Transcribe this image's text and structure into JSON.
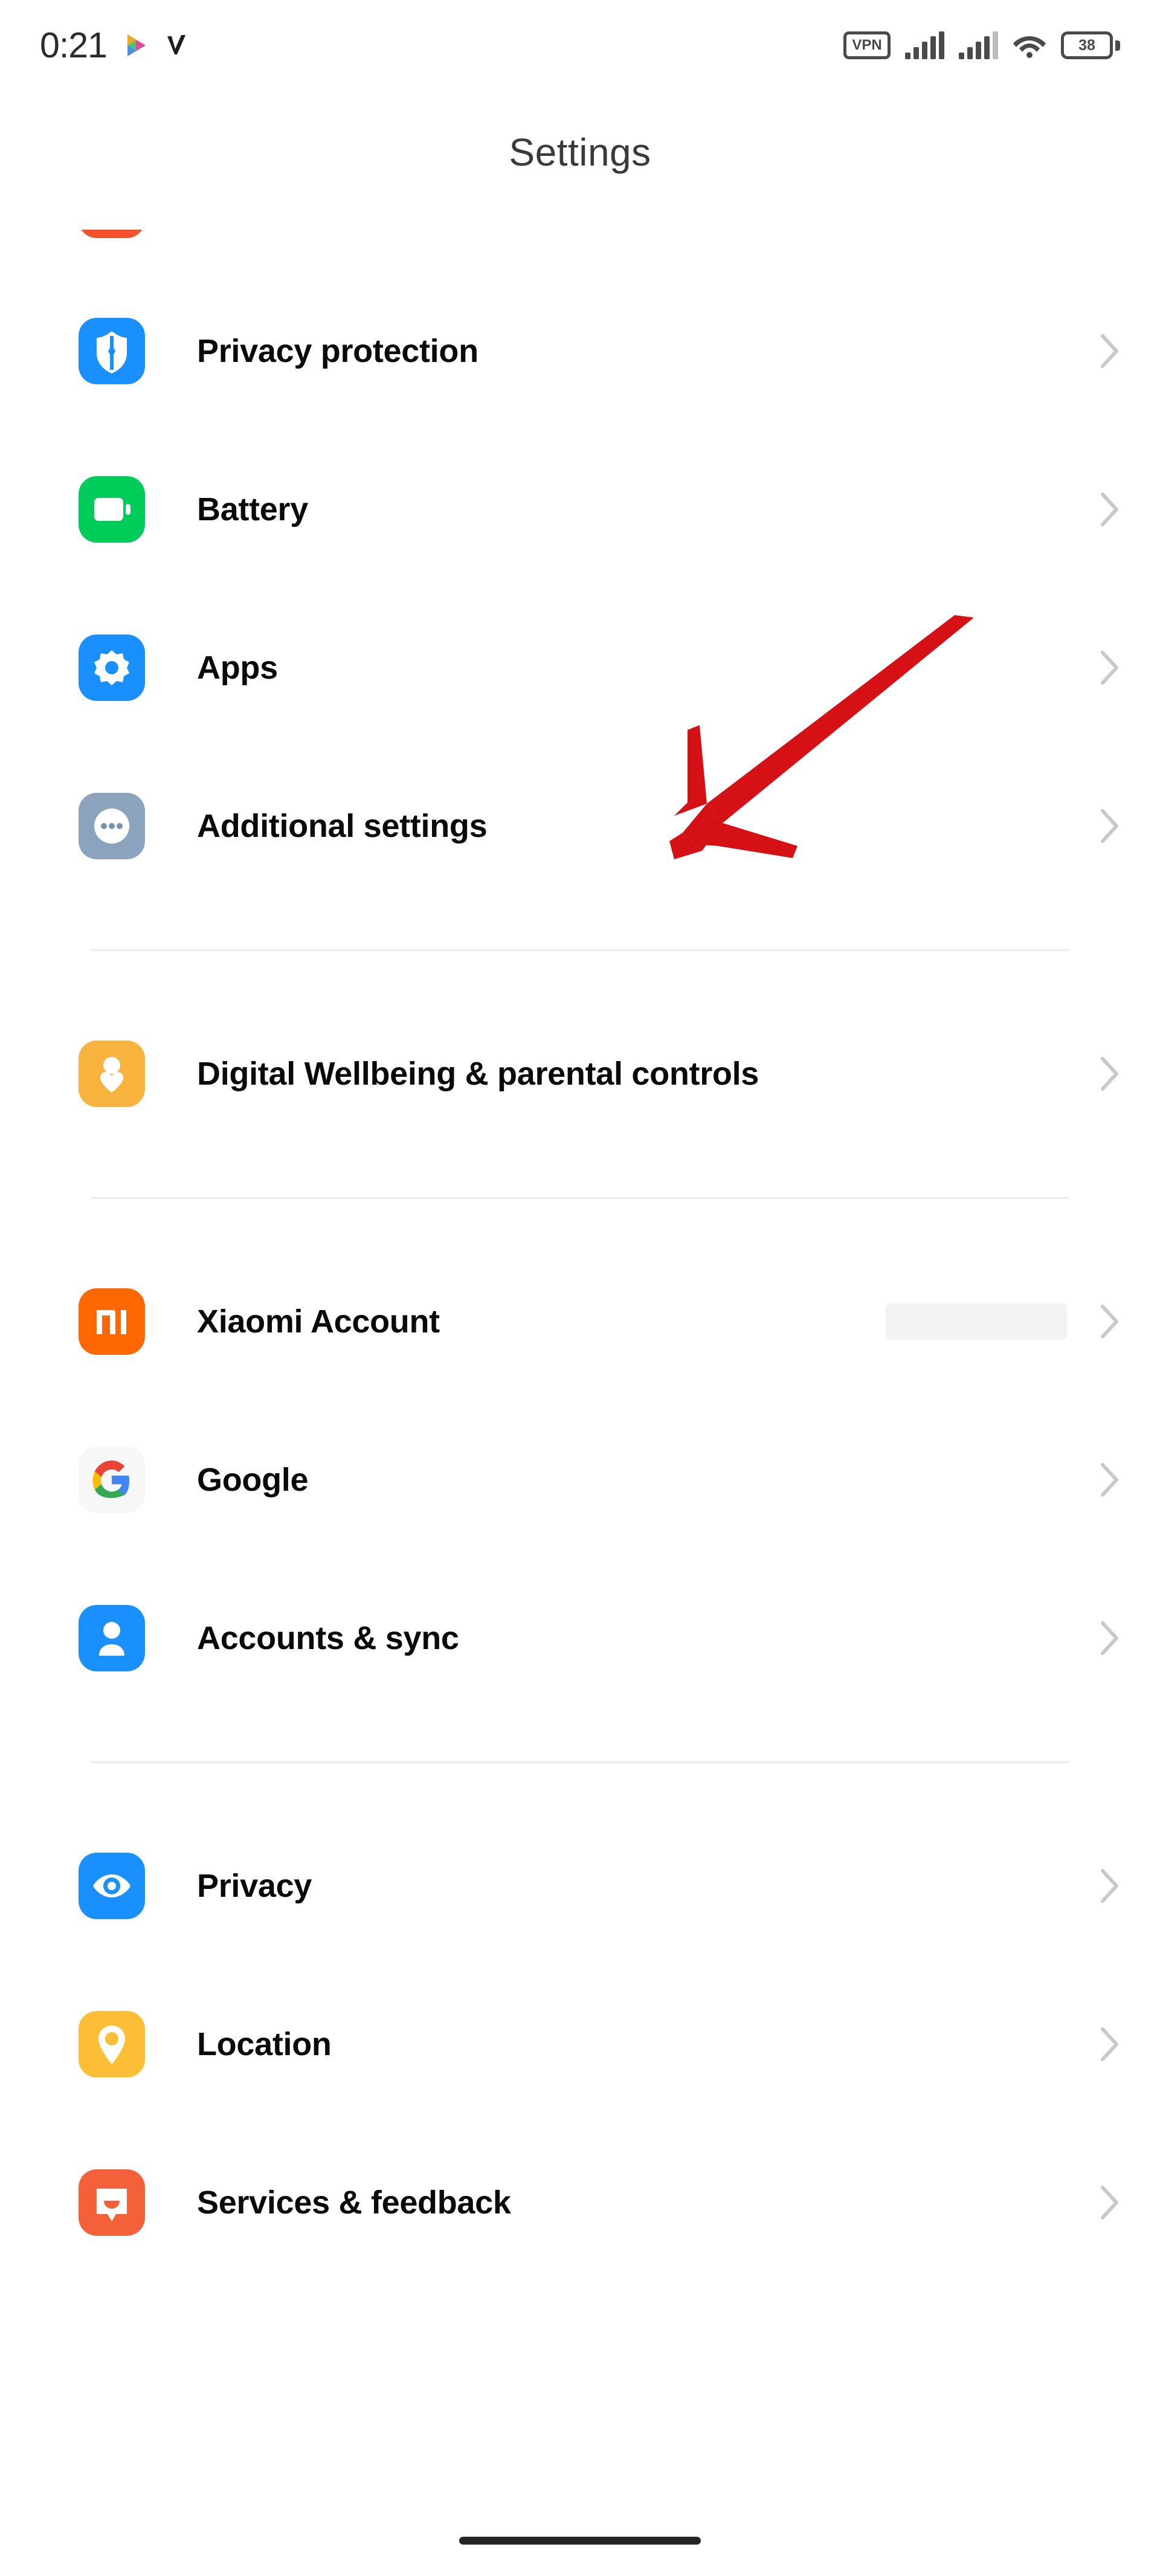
{
  "status_bar": {
    "clock": "0:21",
    "left_icons": [
      "media-play-colorful-icon",
      "checkmark-v-icon"
    ],
    "vpn_label": "VPN",
    "right_icons": [
      "vpn-badge-icon",
      "signal-bars-sim1-icon",
      "signal-bars-sim2-icon",
      "wifi-icon",
      "battery-icon"
    ],
    "battery_level": "38"
  },
  "header": {
    "title": "Settings"
  },
  "annotation": {
    "type": "red-arrow",
    "points_to": "Additional settings",
    "color": "#d61116"
  },
  "groups": [
    {
      "id": "group-system",
      "items": [
        {
          "label": "Privacy protection",
          "icon": "shield-lock-icon",
          "icon_bg": "#1a90ff",
          "chevron": "chevron-right-icon"
        },
        {
          "label": "Battery",
          "icon": "battery-icon",
          "icon_bg": "#00cc5a",
          "chevron": "chevron-right-icon"
        },
        {
          "label": "Apps",
          "icon": "gear-icon",
          "icon_bg": "#1a90ff",
          "chevron": "chevron-right-icon"
        },
        {
          "label": "Additional settings",
          "icon": "more-dots-icon",
          "icon_bg": "#8ba3bd",
          "chevron": "chevron-right-icon"
        }
      ]
    },
    {
      "id": "group-wellbeing",
      "items": [
        {
          "label": "Digital Wellbeing & parental controls",
          "icon": "person-heart-icon",
          "icon_bg": "#f7b33e",
          "chevron": "chevron-right-icon"
        }
      ]
    },
    {
      "id": "group-accounts",
      "items": [
        {
          "label": "Xiaomi Account",
          "icon": "mi-logo-icon",
          "icon_bg": "#ff6700",
          "chevron": "chevron-right-icon",
          "value_redacted": true
        },
        {
          "label": "Google",
          "icon": "google-g-icon",
          "icon_bg": "#f7f7f7",
          "chevron": "chevron-right-icon"
        },
        {
          "label": "Accounts & sync",
          "icon": "person-icon",
          "icon_bg": "#1a90ff",
          "chevron": "chevron-right-icon"
        }
      ]
    },
    {
      "id": "group-privacy",
      "items": [
        {
          "label": "Privacy",
          "icon": "eye-icon",
          "icon_bg": "#1a90ff",
          "chevron": "chevron-right-icon"
        },
        {
          "label": "Location",
          "icon": "location-pin-icon",
          "icon_bg": "#fbbe36",
          "chevron": "chevron-right-icon"
        },
        {
          "label": "Services & feedback",
          "icon": "feedback-face-icon",
          "icon_bg": "#f4603a",
          "chevron": "chevron-right-icon"
        }
      ]
    }
  ],
  "nav": {
    "gesture_bar": "home-gesture-bar"
  }
}
